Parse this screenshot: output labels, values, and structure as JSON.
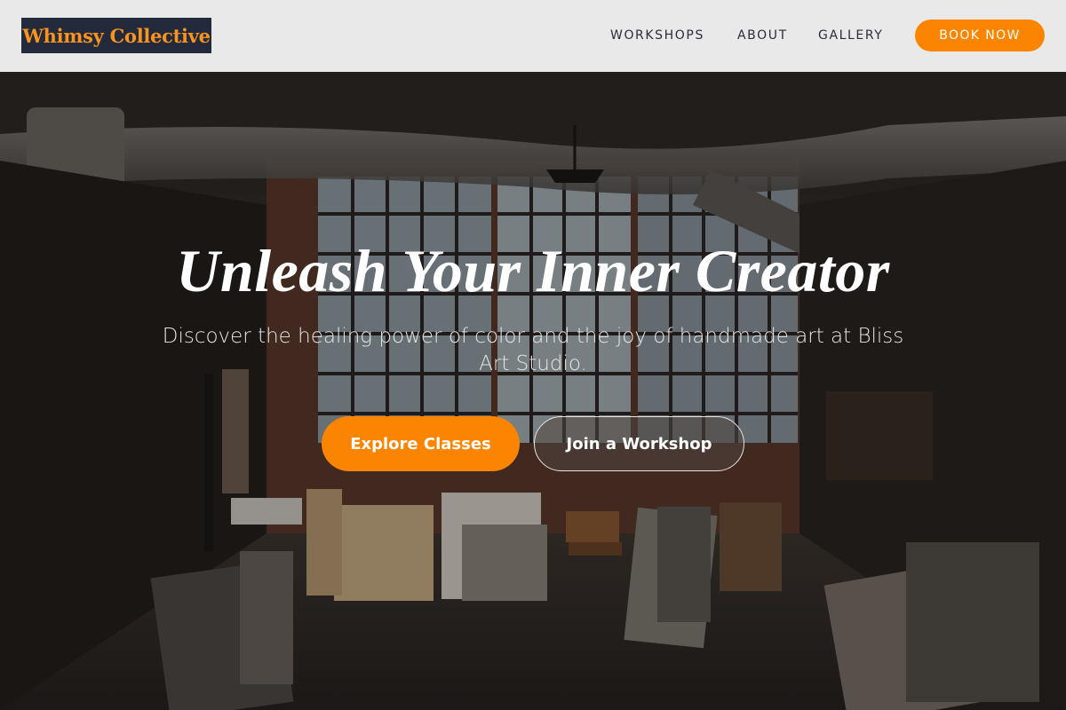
{
  "brand": {
    "name": "Whimsy Collective"
  },
  "nav": {
    "items": [
      {
        "label": "WORKSHOPS"
      },
      {
        "label": "ABOUT"
      },
      {
        "label": "GALLERY"
      }
    ],
    "cta_label": "BOOK NOW"
  },
  "hero": {
    "headline": "Unleash Your Inner Creator",
    "subtext": "Discover the healing power of color and the joy of handmade art at Bliss Art Studio.",
    "primary_cta": "Explore Classes",
    "secondary_cta": "Join a Workshop",
    "background_image": "art studio interior with canvases and industrial windows"
  },
  "colors": {
    "accent": "#fb8500",
    "header_bg": "#e9e9e9",
    "logo_bg": "#232a3b",
    "nav_text": "#2a2d38"
  }
}
